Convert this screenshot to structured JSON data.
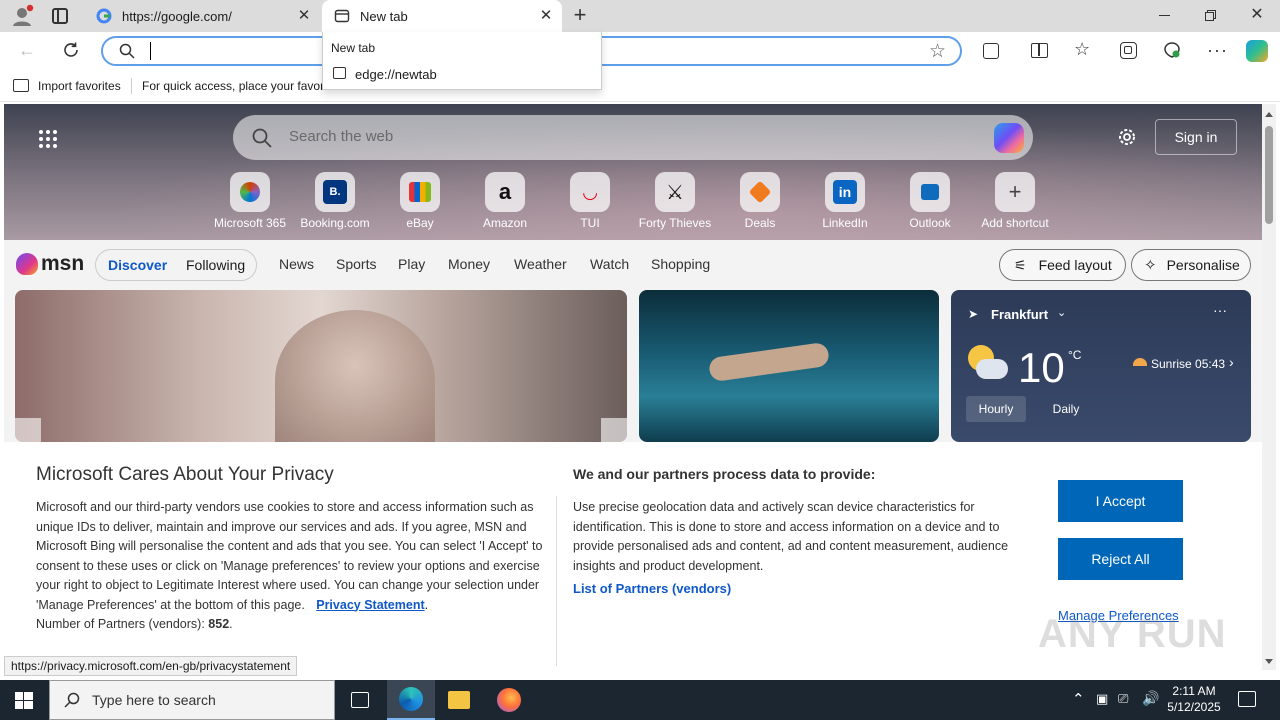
{
  "browser": {
    "tabs": [
      {
        "title": "https://google.com/"
      },
      {
        "title": "New tab"
      }
    ],
    "address_value": "",
    "dropdown": {
      "header": "New tab",
      "item": "edge://newtab"
    },
    "favorites": {
      "import_label": "Import favorites",
      "hint": "For quick access, place your favori"
    }
  },
  "newtab": {
    "search_placeholder": "Search the web",
    "sign_in": "Sign in",
    "shortcuts": [
      {
        "label": "Microsoft 365"
      },
      {
        "label": "Booking.com",
        "glyph": "B."
      },
      {
        "label": "eBay"
      },
      {
        "label": "Amazon",
        "glyph": "a"
      },
      {
        "label": "TUI"
      },
      {
        "label": "Forty Thieves"
      },
      {
        "label": "Deals"
      },
      {
        "label": "LinkedIn",
        "glyph": "in"
      },
      {
        "label": "Outlook"
      },
      {
        "label": "Add shortcut",
        "glyph": "+"
      }
    ]
  },
  "msn": {
    "logo": "msn",
    "tabs": {
      "discover": "Discover",
      "following": "Following"
    },
    "nav": [
      "News",
      "Sports",
      "Play",
      "Money",
      "Weather",
      "Watch",
      "Shopping"
    ],
    "feed_layout": "Feed layout",
    "personalise": "Personalise",
    "weather": {
      "city": "Frankfurt",
      "temp": "10",
      "unit": "°C",
      "sunrise": "Sunrise 05:43",
      "tab_hourly": "Hourly",
      "tab_daily": "Daily"
    }
  },
  "privacy": {
    "title": "Microsoft Cares About Your Privacy",
    "body": "Microsoft and our third-party vendors use cookies to store and access information such as unique IDs to deliver, maintain and improve our services and ads. If you agree, MSN and Microsoft Bing will personalise the content and ads that you see. You can select 'I Accept' to consent to these uses or click on 'Manage preferences' to review your options and exercise your right to object to Legitimate Interest where used.  You can change your selection under 'Manage Preferences' at the bottom of this page.",
    "privacy_link": "Privacy Statement",
    "partners_label": "Number of Partners (vendors):",
    "partners_count": "852",
    "process_title": "We and our partners process data to provide:",
    "process_body": "Use precise geolocation data and actively scan device characteristics for identification. This is done to store and access information on a device and to provide personalised ads and content, ad and content measurement, audience insights and product development.",
    "list_link": "List of Partners (vendors)",
    "accept": "I Accept",
    "reject": "Reject All",
    "manage": "Manage Preferences"
  },
  "status_url": "https://privacy.microsoft.com/en-gb/privacystatement",
  "taskbar": {
    "search_placeholder": "Type here to search",
    "time": "2:11 AM",
    "date": "5/12/2025"
  },
  "watermark": "ANY RUN"
}
